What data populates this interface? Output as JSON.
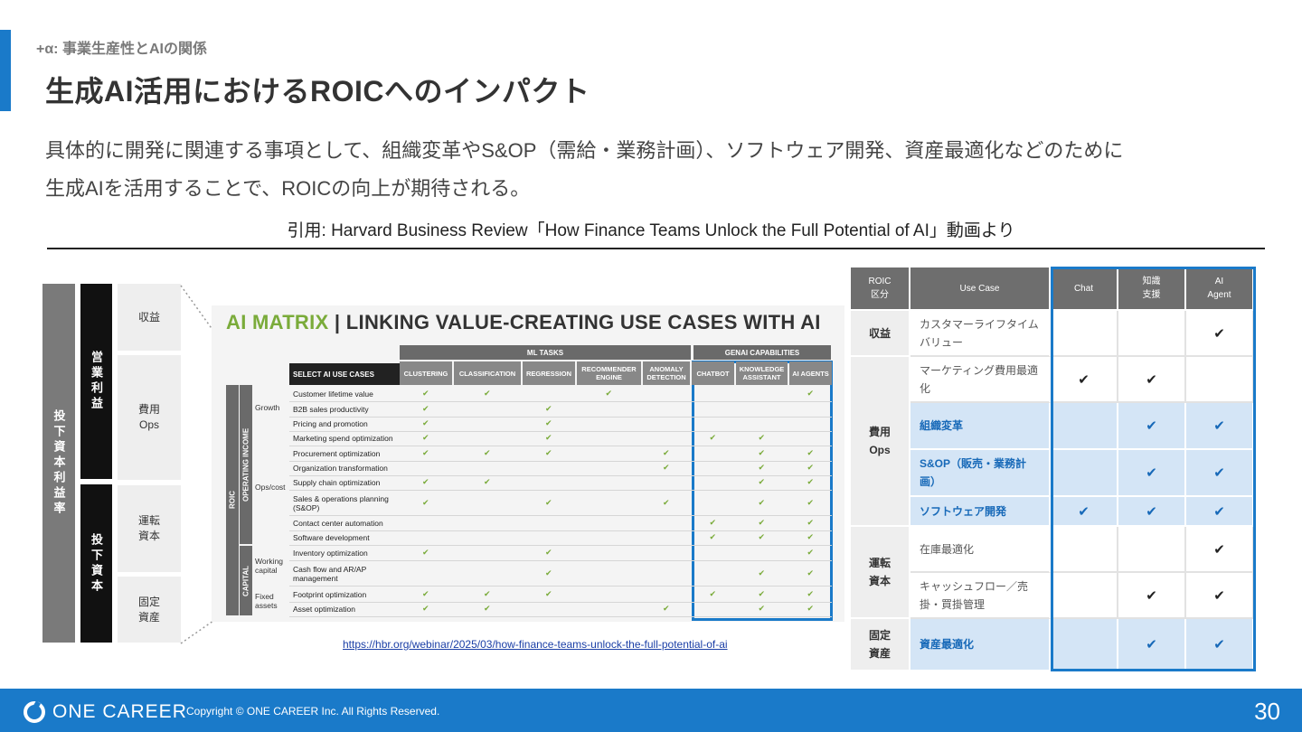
{
  "header": {
    "eyebrow": "+α: 事業生産性とAIの関係",
    "title": "生成AI活用におけるROICへのインパクト"
  },
  "body": {
    "line1": "具体的に開発に関連する事項として、組織変革やS&OP（需給・業務計画）、ソフトウェア開発、資産最適化などのために",
    "line2": "生成AIを活用することで、ROICの向上が期待される。"
  },
  "citation": "引用: Harvard Business Review「How Finance Teams Unlock the Full Potential of AI」動画より",
  "tree": {
    "invested_capital_margin": "投下資本利益率",
    "operating_profit": "営業利益",
    "invested_capital": "投下資本",
    "revenue": "収益",
    "cost_line1": "費用",
    "cost_line2": "Ops",
    "working_capital_line1": "運転",
    "working_capital_line2": "資本",
    "fixed_asset_line1": "固定",
    "fixed_asset_line2": "資産"
  },
  "matrix": {
    "title_green": "AI MATRIX",
    "title_rest": " | LINKING VALUE-CREATING USE CASES WITH AI",
    "band_ml": "ML TASKS",
    "band_genai": "GENAI CAPABILITIES",
    "select_head": "SELECT AI USE CASES",
    "columns": [
      "CLUSTERING",
      "CLASSIFICATION",
      "REGRESSION",
      "RECOMMENDER ENGINE",
      "ANOMALY DETECTION",
      "CHATBOT",
      "KNOWLEDGE ASSISTANT",
      "AI AGENTS"
    ],
    "side_roic": "ROIC",
    "side_opinc": "OPERATING INCOME",
    "side_capital": "CAPITAL",
    "groups": [
      "Growth",
      "Ops/cost",
      "Working capital",
      "Fixed assets"
    ],
    "rows": [
      {
        "label": "Customer lifetime value",
        "checks": [
          1,
          1,
          0,
          1,
          0,
          0,
          0,
          1
        ]
      },
      {
        "label": "B2B sales productivity",
        "checks": [
          1,
          0,
          1,
          0,
          0,
          0,
          0,
          0
        ]
      },
      {
        "label": "Pricing and promotion",
        "checks": [
          1,
          0,
          1,
          0,
          0,
          0,
          0,
          0
        ]
      },
      {
        "label": "Marketing spend optimization",
        "checks": [
          1,
          0,
          1,
          0,
          0,
          1,
          1,
          0
        ]
      },
      {
        "label": "Procurement optimization",
        "checks": [
          1,
          1,
          1,
          0,
          1,
          0,
          1,
          1
        ]
      },
      {
        "label": "Organization transformation",
        "checks": [
          0,
          0,
          0,
          0,
          1,
          0,
          1,
          1
        ]
      },
      {
        "label": "Supply chain optimization",
        "checks": [
          1,
          1,
          0,
          0,
          0,
          0,
          1,
          1
        ]
      },
      {
        "label": "Sales & operations planning (S&OP)",
        "checks": [
          1,
          0,
          1,
          0,
          1,
          0,
          1,
          1
        ]
      },
      {
        "label": "Contact center automation",
        "checks": [
          0,
          0,
          0,
          0,
          0,
          1,
          1,
          1
        ]
      },
      {
        "label": "Software development",
        "checks": [
          0,
          0,
          0,
          0,
          0,
          1,
          1,
          1
        ]
      },
      {
        "label": "Inventory optimization",
        "checks": [
          1,
          0,
          1,
          0,
          0,
          0,
          0,
          1
        ]
      },
      {
        "label": "Cash flow and AR/AP management",
        "checks": [
          0,
          0,
          1,
          0,
          0,
          0,
          1,
          1
        ]
      },
      {
        "label": "Footprint optimization",
        "checks": [
          1,
          1,
          1,
          0,
          0,
          1,
          1,
          1
        ]
      },
      {
        "label": "Asset optimization",
        "checks": [
          1,
          1,
          0,
          0,
          1,
          0,
          1,
          1
        ]
      }
    ],
    "check_glyph": "✔"
  },
  "link": "https://hbr.org/webinar/2025/03/how-finance-teams-unlock-the-full-potential-of-ai",
  "table": {
    "headers": {
      "roic_line1": "ROIC",
      "roic_line2": "区分",
      "usecase": "Use Case",
      "chat": "Chat",
      "knowledge_line1": "知識",
      "knowledge_line2": "支援",
      "agent_line1": "AI",
      "agent_line2": "Agent"
    },
    "categories": {
      "revenue": "収益",
      "cost_line1": "費用",
      "cost_line2": "Ops",
      "working_line1": "運転",
      "working_line2": "資本",
      "fixed_line1": "固定",
      "fixed_line2": "資産"
    },
    "check": "✔",
    "rows": [
      {
        "label_line1": "カスタマーライフタイム",
        "label_line2": "バリュー",
        "chat": false,
        "knowledge": false,
        "agent": true,
        "highlight": false
      },
      {
        "label_line1": "マーケティング費用最適",
        "label_line2": "化",
        "chat": true,
        "knowledge": true,
        "agent": false,
        "highlight": false
      },
      {
        "label_line1": "組織変革",
        "label_line2": "",
        "chat": false,
        "knowledge": true,
        "agent": true,
        "highlight": true
      },
      {
        "label_line1": "S&OP（販売・業務計",
        "label_line2": "画）",
        "chat": false,
        "knowledge": true,
        "agent": true,
        "highlight": true
      },
      {
        "label_line1": "ソフトウェア開発",
        "label_line2": "",
        "chat": true,
        "knowledge": true,
        "agent": true,
        "highlight": true
      },
      {
        "label_line1": "在庫最適化",
        "label_line2": "",
        "chat": false,
        "knowledge": false,
        "agent": true,
        "highlight": false
      },
      {
        "label_line1": "キャッシュフロー／売",
        "label_line2": "掛・買掛管理",
        "chat": false,
        "knowledge": true,
        "agent": true,
        "highlight": false
      },
      {
        "label_line1": "資産最適化",
        "label_line2": "",
        "chat": false,
        "knowledge": true,
        "agent": true,
        "highlight": true
      }
    ]
  },
  "footer": {
    "logo": "ONE CAREER",
    "copyright": "Copyright © ONE CAREER Inc. All Rights Reserved.",
    "page": "30"
  },
  "colors": {
    "brand_blue": "#1a7ac9",
    "highlight_bg": "#d4e5f6",
    "check_green": "#7aab3a"
  }
}
